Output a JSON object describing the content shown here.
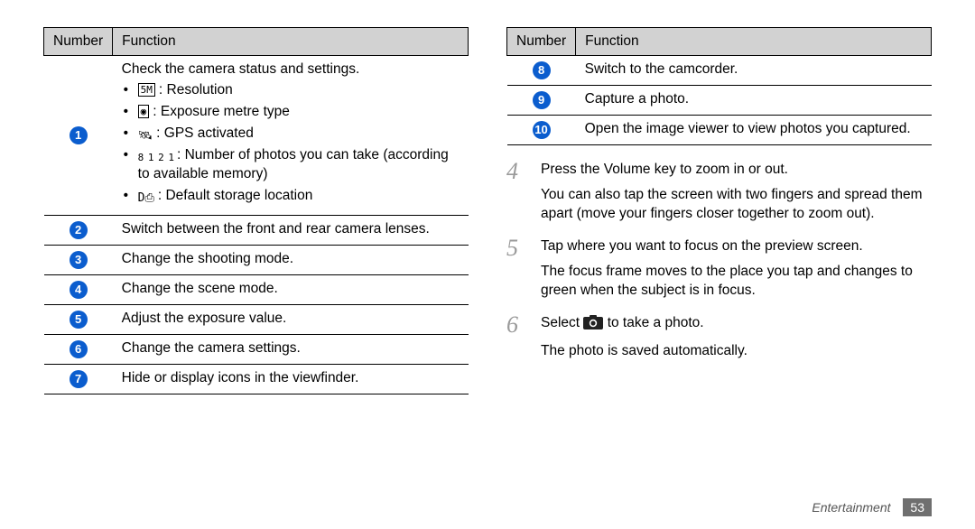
{
  "headers": {
    "number": "Number",
    "function": "Function"
  },
  "left_rows": [
    {
      "n": "1",
      "intro": "Check the camera status and settings.",
      "bullets": [
        {
          "icon_name": "resolution-icon",
          "icon_glyph": "5M",
          "boxed": true,
          "text": "Resolution"
        },
        {
          "icon_name": "exposure-icon",
          "icon_glyph": "◉",
          "boxed": true,
          "text": "Exposure metre type"
        },
        {
          "icon_name": "gps-icon",
          "icon_glyph": "🛰",
          "boxed": false,
          "text": "GPS activated"
        },
        {
          "icon_name": "count-icon",
          "icon_glyph": "8 1 2 1",
          "boxed": false,
          "tiny": true,
          "text": "Number of photos you can take (according to available memory)"
        },
        {
          "icon_name": "storage-icon",
          "icon_glyph": "D⎙",
          "boxed": false,
          "text": "Default storage location"
        }
      ]
    },
    {
      "n": "2",
      "text": "Switch between the front and rear camera lenses."
    },
    {
      "n": "3",
      "text": "Change the shooting mode."
    },
    {
      "n": "4",
      "text": "Change the scene mode."
    },
    {
      "n": "5",
      "text": "Adjust the exposure value."
    },
    {
      "n": "6",
      "text": "Change the camera settings."
    },
    {
      "n": "7",
      "text": "Hide or display icons in the viewfinder."
    }
  ],
  "right_rows": [
    {
      "n": "8",
      "text": "Switch to the camcorder."
    },
    {
      "n": "9",
      "text": "Capture a photo."
    },
    {
      "n": "10",
      "text": "Open the image viewer to view photos you captured."
    }
  ],
  "steps": [
    {
      "n": "4",
      "lines": [
        "Press the Volume key to zoom in or out.",
        "You can also tap the screen with two fingers and spread them apart (move your fingers closer together to zoom out)."
      ]
    },
    {
      "n": "5",
      "lines": [
        "Tap where you want to focus on the preview screen.",
        "The focus frame moves to the place you tap and changes to green when the subject is in focus."
      ]
    },
    {
      "n": "6",
      "pre": "Select ",
      "post": " to take a photo.",
      "extra": "The photo is saved automatically."
    }
  ],
  "footer": {
    "section": "Entertainment",
    "page": "53"
  }
}
